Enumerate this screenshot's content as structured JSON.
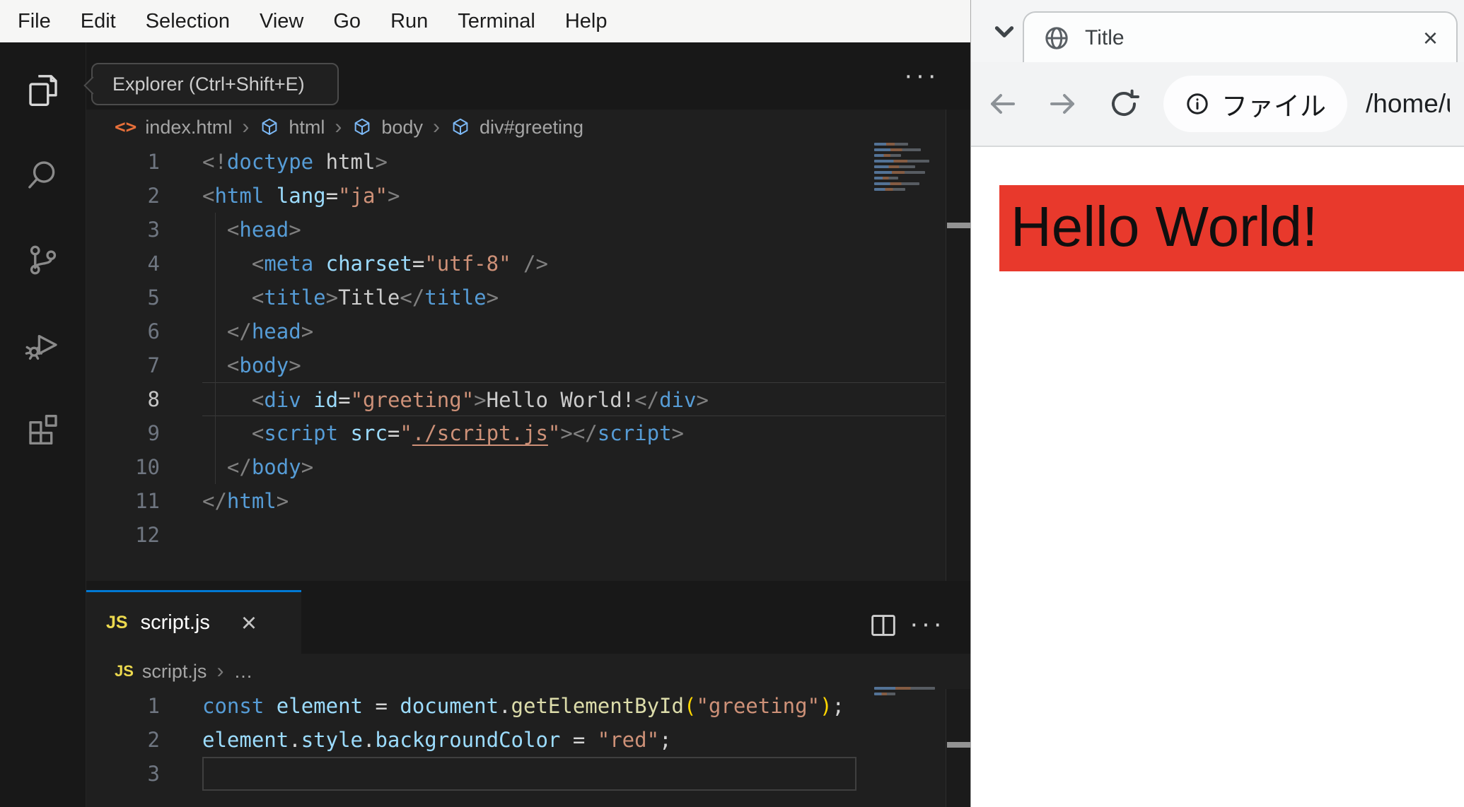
{
  "colors": {
    "accent_blue": "#0078d4",
    "page_red": "#e8392c",
    "menu_bg": "#f6f6f5",
    "editor_bg": "#1f1f1f",
    "strip_bg": "#181818"
  },
  "token_colors": {
    "p": "#808080",
    "tag": "#569cd6",
    "attr": "#9cdcfe",
    "str": "#ce9178",
    "txt": "#cccccc",
    "kw": "#569cd6",
    "var": "#9cdcfe",
    "fn": "#dcdcaa",
    "br": "#ffd700",
    "op": "#d4d4d4",
    "link": "#ce9178"
  },
  "menu_bar": {
    "items": [
      "File",
      "Edit",
      "Selection",
      "View",
      "Go",
      "Run",
      "Terminal",
      "Help"
    ]
  },
  "activity_bar": {
    "tooltip": "Explorer (Ctrl+Shift+E)"
  },
  "editor_top": {
    "more_icon": "···",
    "breadcrumb": {
      "file_icon": "<>",
      "file": "index.html",
      "sep": "›",
      "node1": "html",
      "node2": "body",
      "node3": "div#greeting"
    },
    "current_line": 8,
    "lines": [
      {
        "n": 1,
        "tokens": [
          [
            "p",
            "<!"
          ],
          [
            "tag",
            "doctype"
          ],
          [
            "txt",
            " html"
          ],
          [
            "p",
            ">"
          ]
        ]
      },
      {
        "n": 2,
        "tokens": [
          [
            "p",
            "<"
          ],
          [
            "tag",
            "html"
          ],
          [
            "attr",
            " lang"
          ],
          [
            "op",
            "="
          ],
          [
            "str",
            "\"ja\""
          ],
          [
            "p",
            ">"
          ]
        ]
      },
      {
        "n": 3,
        "tokens": [
          [
            "op",
            "  "
          ],
          [
            "p",
            "<"
          ],
          [
            "tag",
            "head"
          ],
          [
            "p",
            ">"
          ]
        ]
      },
      {
        "n": 4,
        "tokens": [
          [
            "op",
            "    "
          ],
          [
            "p",
            "<"
          ],
          [
            "tag",
            "meta"
          ],
          [
            "attr",
            " charset"
          ],
          [
            "op",
            "="
          ],
          [
            "str",
            "\"utf-8\""
          ],
          [
            "txt",
            " "
          ],
          [
            "p",
            "/>"
          ]
        ]
      },
      {
        "n": 5,
        "tokens": [
          [
            "op",
            "    "
          ],
          [
            "p",
            "<"
          ],
          [
            "tag",
            "title"
          ],
          [
            "p",
            ">"
          ],
          [
            "txt",
            "Title"
          ],
          [
            "p",
            "</"
          ],
          [
            "tag",
            "title"
          ],
          [
            "p",
            ">"
          ]
        ]
      },
      {
        "n": 6,
        "tokens": [
          [
            "op",
            "  "
          ],
          [
            "p",
            "</"
          ],
          [
            "tag",
            "head"
          ],
          [
            "p",
            ">"
          ]
        ]
      },
      {
        "n": 7,
        "tokens": [
          [
            "op",
            "  "
          ],
          [
            "p",
            "<"
          ],
          [
            "tag",
            "body"
          ],
          [
            "p",
            ">"
          ]
        ]
      },
      {
        "n": 8,
        "tokens": [
          [
            "op",
            "    "
          ],
          [
            "p",
            "<"
          ],
          [
            "tag",
            "div"
          ],
          [
            "attr",
            " id"
          ],
          [
            "op",
            "="
          ],
          [
            "str",
            "\"greeting\""
          ],
          [
            "p",
            ">"
          ],
          [
            "txt",
            "Hello World!"
          ],
          [
            "p",
            "</"
          ],
          [
            "tag",
            "div"
          ],
          [
            "p",
            ">"
          ]
        ]
      },
      {
        "n": 9,
        "tokens": [
          [
            "op",
            "    "
          ],
          [
            "p",
            "<"
          ],
          [
            "tag",
            "script"
          ],
          [
            "attr",
            " src"
          ],
          [
            "op",
            "="
          ],
          [
            "str",
            "\""
          ],
          [
            "link",
            "./script.js"
          ],
          [
            "str",
            "\""
          ],
          [
            "p",
            "></"
          ],
          [
            "tag",
            "script"
          ],
          [
            "p",
            ">"
          ]
        ]
      },
      {
        "n": 10,
        "tokens": [
          [
            "op",
            "  "
          ],
          [
            "p",
            "</"
          ],
          [
            "tag",
            "body"
          ],
          [
            "p",
            ">"
          ]
        ]
      },
      {
        "n": 11,
        "tokens": [
          [
            "p",
            "</"
          ],
          [
            "tag",
            "html"
          ],
          [
            "p",
            ">"
          ]
        ]
      },
      {
        "n": 12,
        "tokens": []
      }
    ]
  },
  "editor_bottom": {
    "tab_label": "script.js",
    "tab_icon": "JS",
    "close_icon": "×",
    "more_icon": "···",
    "breadcrumb": {
      "icon": "JS",
      "file": "script.js",
      "sep": "›",
      "ellipsis": "…"
    },
    "current_line": 3,
    "lines": [
      {
        "n": 1,
        "tokens": [
          [
            "kw",
            "const"
          ],
          [
            "var",
            " element"
          ],
          [
            "op",
            " = "
          ],
          [
            "var",
            "document"
          ],
          [
            "op",
            "."
          ],
          [
            "fn",
            "getElementById"
          ],
          [
            "br",
            "("
          ],
          [
            "str",
            "\"greeting\""
          ],
          [
            "br",
            ")"
          ],
          [
            "op",
            ";"
          ]
        ]
      },
      {
        "n": 2,
        "tokens": [
          [
            "var",
            "element"
          ],
          [
            "op",
            "."
          ],
          [
            "var",
            "style"
          ],
          [
            "op",
            "."
          ],
          [
            "var",
            "backgroundColor"
          ],
          [
            "op",
            " = "
          ],
          [
            "str",
            "\"red\""
          ],
          [
            "op",
            ";"
          ]
        ]
      },
      {
        "n": 3,
        "tokens": []
      }
    ]
  },
  "browser": {
    "tab": {
      "title": "Title",
      "close_icon": "×"
    },
    "toolbar": {
      "chip_label": "ファイル",
      "url": "/home/u"
    },
    "page": {
      "heading": "Hello World!"
    }
  }
}
